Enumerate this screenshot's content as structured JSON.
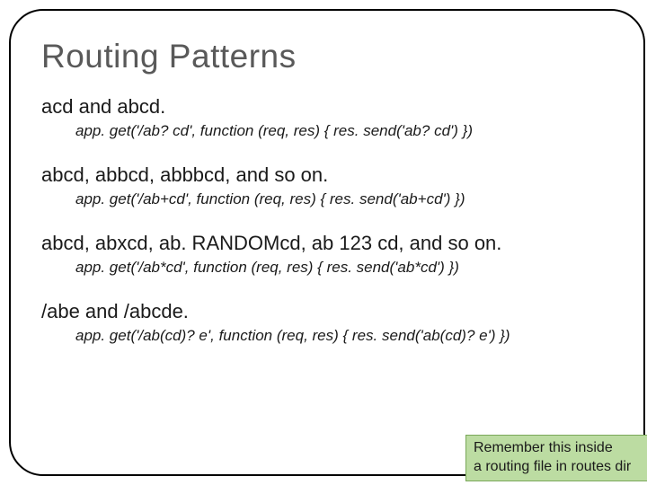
{
  "title": "Routing Patterns",
  "sections": [
    {
      "desc": "acd and abcd.",
      "code": "app. get('/ab? cd', function (req, res) { res. send('ab? cd') })"
    },
    {
      "desc": "abcd, abbcd, abbbcd, and so on.",
      "code": "app. get('/ab+cd', function (req, res) { res. send('ab+cd') })"
    },
    {
      "desc": "abcd, abxcd, ab. RANDOMcd, ab 123 cd, and so on.",
      "code": "app. get('/ab*cd', function (req, res) { res. send('ab*cd') })"
    },
    {
      "desc": "/abe and /abcde.",
      "code": "app. get('/ab(cd)? e', function (req, res) { res. send('ab(cd)? e') })"
    }
  ],
  "note_line1": "Remember this inside",
  "note_line2": "a routing file in routes dir"
}
